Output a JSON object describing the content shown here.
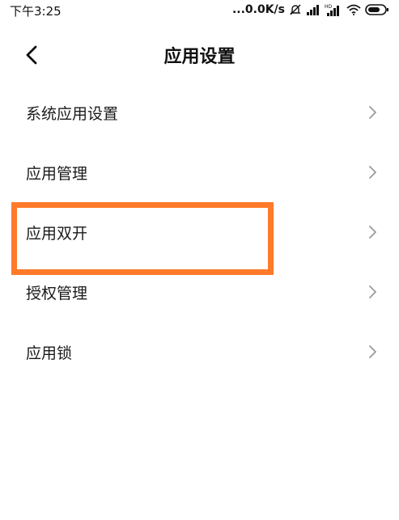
{
  "status_bar": {
    "time": "下午3:25",
    "net_speed": "...0.0K/s",
    "icons": [
      "mute-bell-icon",
      "signal-icon",
      "hd-signal-icon",
      "wifi-icon",
      "battery-icon"
    ]
  },
  "header": {
    "title": "应用设置",
    "back_icon": "chevron-left-icon"
  },
  "list": {
    "items": [
      {
        "label": "系统应用设置"
      },
      {
        "label": "应用管理"
      },
      {
        "label": "应用双开"
      },
      {
        "label": "授权管理"
      },
      {
        "label": "应用锁"
      }
    ]
  },
  "colors": {
    "highlight": "#ff7a2a",
    "chevron": "#9a9a9a",
    "text": "#1a1a1a",
    "background": "#ffffff"
  }
}
